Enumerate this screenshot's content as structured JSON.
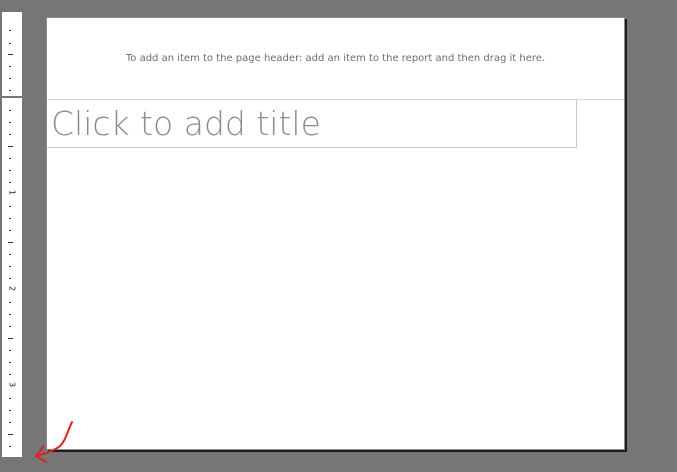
{
  "page": {
    "header_hint": "To add an item to the page header: add an item to the report and then drag it here.",
    "title_placeholder": "Click to add title"
  },
  "ruler": {
    "labels": [
      "1",
      "2",
      "3"
    ]
  },
  "colors": {
    "background": "#767676",
    "annotation": "#e02020"
  }
}
